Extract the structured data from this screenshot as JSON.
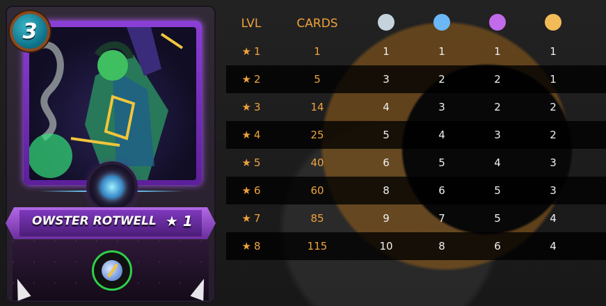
{
  "card": {
    "mana": "3",
    "name": "OWSTER ROTWELL",
    "level_label": "★ 1",
    "colors": {
      "frame": "#8a3fd6",
      "mana": "#0b6f86",
      "ability_ring": "#2fd14a"
    },
    "icons": [
      "skull-emblem-icon",
      "magic-reflect-ability-icon"
    ]
  },
  "stats_table": {
    "headers": {
      "lvl": "LVL",
      "cards": "CARDS"
    },
    "stat_icons": [
      {
        "icon": "white-dot-icon",
        "color": "#c5d3dc"
      },
      {
        "icon": "blue-dot-icon",
        "color": "#6cb7f5"
      },
      {
        "icon": "purple-dot-icon",
        "color": "#c26bea"
      },
      {
        "icon": "yellow-dot-icon",
        "color": "#f2bb58"
      }
    ],
    "rows": [
      {
        "lvl": "1",
        "cards": "1",
        "s1": "1",
        "s2": "1",
        "s3": "1",
        "s4": "1"
      },
      {
        "lvl": "2",
        "cards": "5",
        "s1": "3",
        "s2": "2",
        "s3": "2",
        "s4": "1"
      },
      {
        "lvl": "3",
        "cards": "14",
        "s1": "4",
        "s2": "3",
        "s3": "2",
        "s4": "2"
      },
      {
        "lvl": "4",
        "cards": "25",
        "s1": "5",
        "s2": "4",
        "s3": "3",
        "s4": "2"
      },
      {
        "lvl": "5",
        "cards": "40",
        "s1": "6",
        "s2": "5",
        "s3": "4",
        "s4": "3"
      },
      {
        "lvl": "6",
        "cards": "60",
        "s1": "8",
        "s2": "6",
        "s3": "5",
        "s4": "3"
      },
      {
        "lvl": "7",
        "cards": "85",
        "s1": "9",
        "s2": "7",
        "s3": "5",
        "s4": "4"
      },
      {
        "lvl": "8",
        "cards": "115",
        "s1": "10",
        "s2": "8",
        "s3": "6",
        "s4": "4"
      }
    ],
    "star_glyph": "★",
    "accent_color": "#f0a33b"
  }
}
